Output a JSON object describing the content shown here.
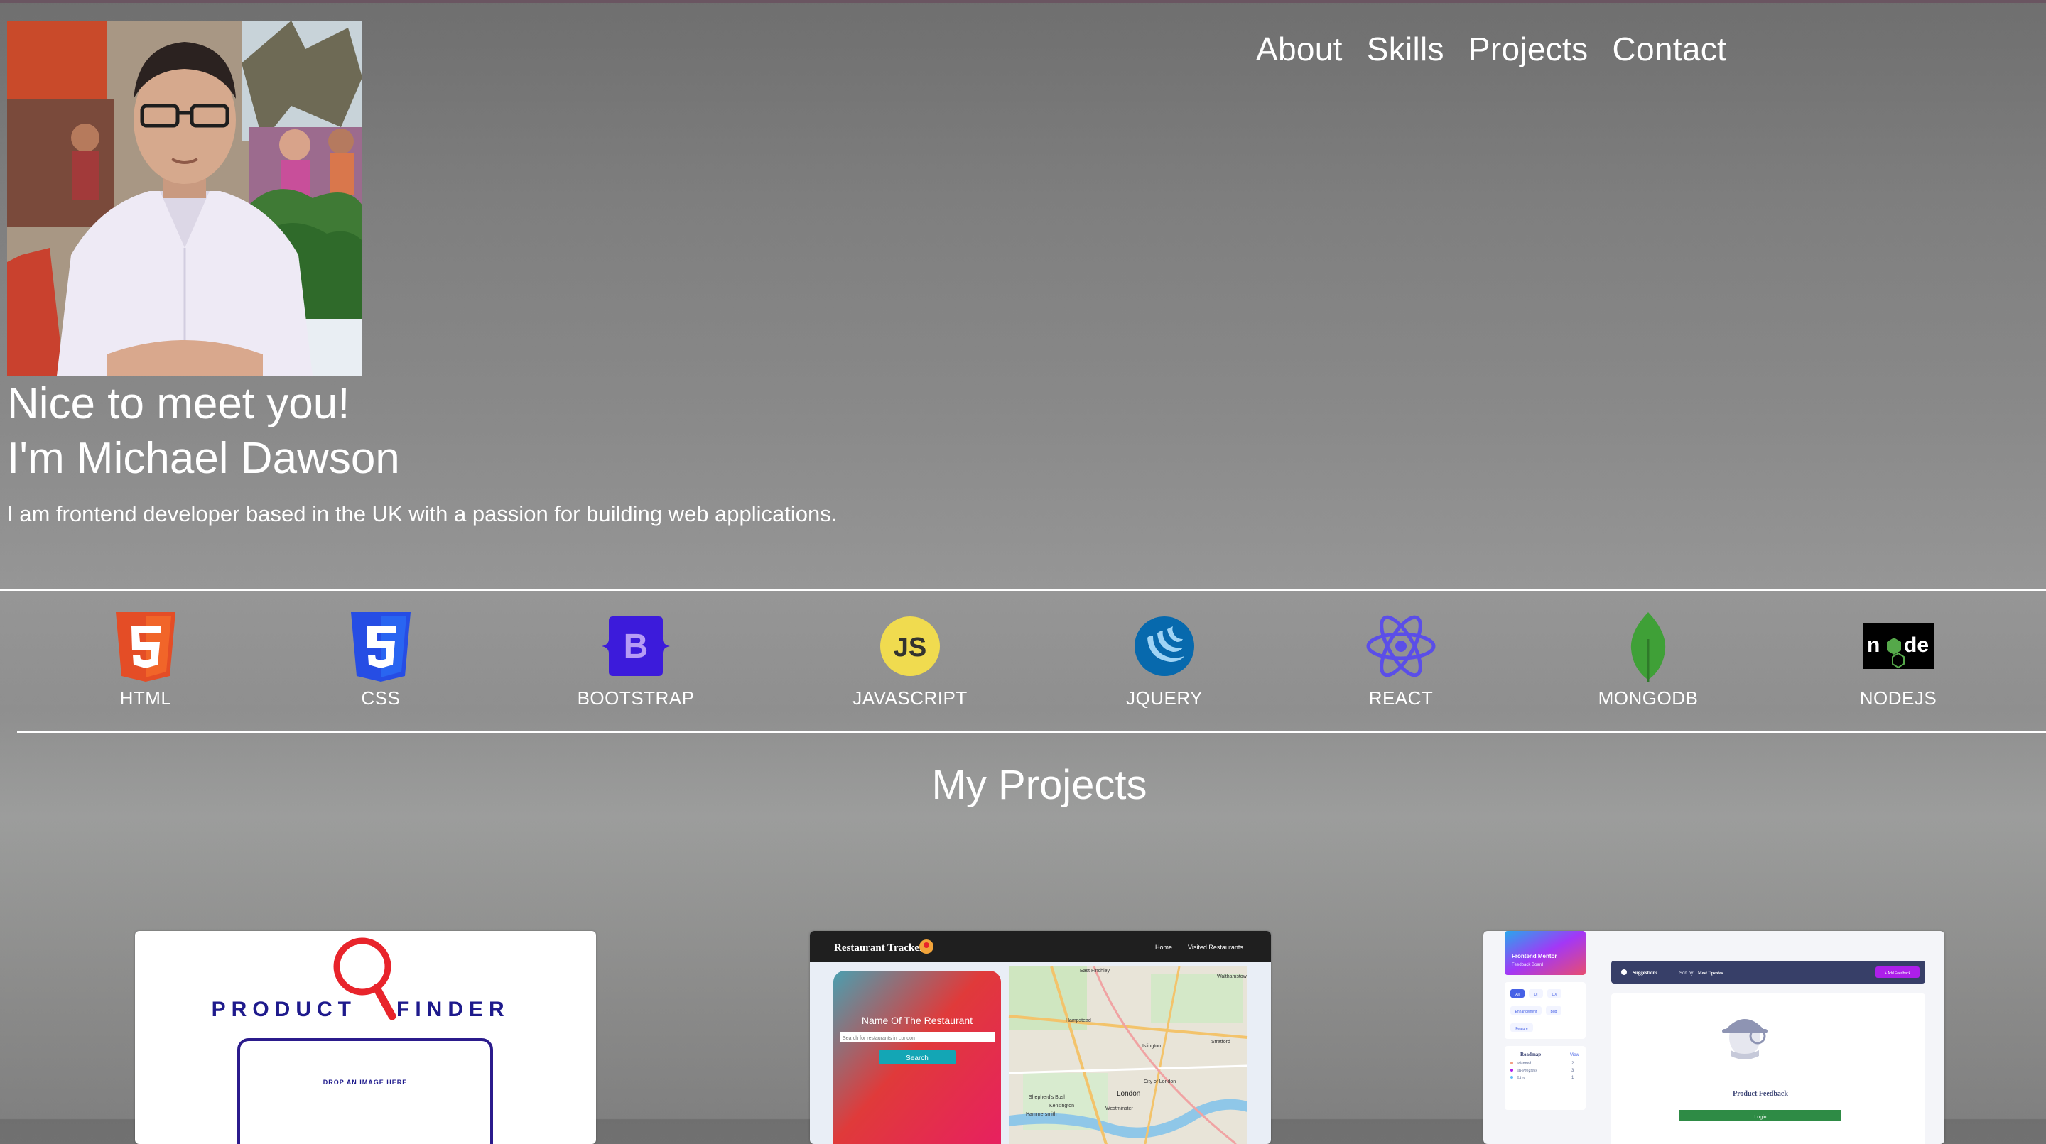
{
  "nav": {
    "items": [
      "About",
      "Skills",
      "Projects",
      "Contact"
    ]
  },
  "hero": {
    "greeting": "Nice to meet you!",
    "name": "I'm Michael Dawson",
    "description": "I am frontend developer based in the UK with a passion for building web applications."
  },
  "skills": [
    {
      "label": "HTML",
      "icon": "html5-icon",
      "color": "#e44d26"
    },
    {
      "label": "CSS",
      "icon": "css3-icon",
      "color": "#264de4"
    },
    {
      "label": "BOOTSTRAP",
      "icon": "bootstrap-icon",
      "color": "#3c1bdb"
    },
    {
      "label": "JAVASCRIPT",
      "icon": "javascript-icon",
      "color": "#f0db4f"
    },
    {
      "label": "JQUERY",
      "icon": "jquery-icon",
      "color": "#0769ad"
    },
    {
      "label": "REACT",
      "icon": "react-icon",
      "color": "#5b4ee8"
    },
    {
      "label": "MONGODB",
      "icon": "mongodb-icon",
      "color": "#3fa037"
    },
    {
      "label": "NODEJS",
      "icon": "nodejs-icon",
      "color": "#000000"
    }
  ],
  "projects": {
    "title": "My Projects",
    "product_finder": {
      "logo_left": "PRODUCT",
      "logo_right": "FINDER",
      "drop_text": "DROP AN IMAGE HERE"
    },
    "restaurant_tracker": {
      "brand": "Restaurant Tracker",
      "nav": [
        "Home",
        "Visited Restaurants"
      ],
      "card_title": "Name Of The Restaurant",
      "search_placeholder": "Search for restaurants in London",
      "search_button": "Search",
      "map_labels": [
        "East Finchley",
        "Walthamstow",
        "Hampstead",
        "Islington",
        "Stratford",
        "City of London",
        "London",
        "Kensington",
        "Westminster",
        "Hammersmith",
        "Shepherd's Bush"
      ]
    },
    "feedback_board": {
      "brand_title": "Frontend Mentor",
      "brand_sub": "Feedback Board",
      "filters": [
        "All",
        "UI",
        "UX",
        "Enhancement",
        "Bug",
        "Feature"
      ],
      "roadmap_title": "Roadmap",
      "roadmap_view": "View",
      "roadmap_items": [
        {
          "label": "Planned",
          "count": "2",
          "color": "#f49f85"
        },
        {
          "label": "In-Progress",
          "count": "3",
          "color": "#ad1fea"
        },
        {
          "label": "Live",
          "count": "1",
          "color": "#62bcfa"
        }
      ],
      "suggestions_label": "Suggestions",
      "sort_label": "Sort by:",
      "sort_value": "Most Upvotes",
      "add_button": "+ Add Feedback",
      "empty_title": "Product Feedback",
      "login_button": "Login"
    }
  }
}
